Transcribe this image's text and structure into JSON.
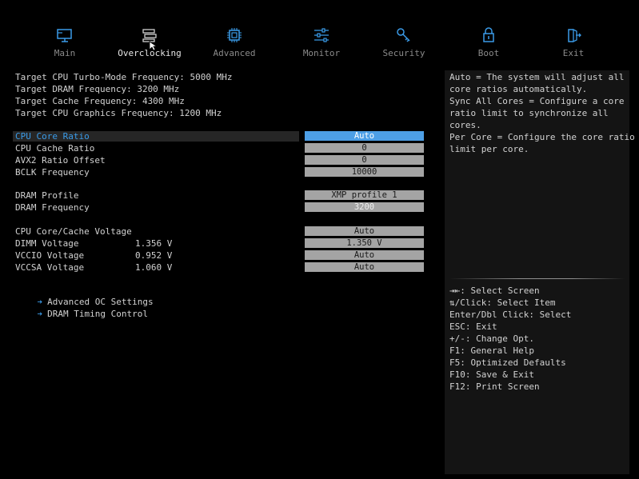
{
  "nav": {
    "items": [
      {
        "label": "Main",
        "icon": "computer-icon"
      },
      {
        "label": "Overclocking",
        "icon": "overclock-icon"
      },
      {
        "label": "Advanced",
        "icon": "chip-icon"
      },
      {
        "label": "Monitor",
        "icon": "sliders-icon"
      },
      {
        "label": "Security",
        "icon": "key-icon"
      },
      {
        "label": "Boot",
        "icon": "lock-icon"
      },
      {
        "label": "Exit",
        "icon": "exit-icon"
      }
    ],
    "active": "Overclocking",
    "accent": "#3a9be8"
  },
  "targets": [
    "Target CPU Turbo-Mode Frequency: 5000 MHz",
    "Target DRAM Frequency: 3200 MHz",
    "Target Cache Frequency: 4300 MHz",
    "Target CPU Graphics Frequency: 1200 MHz"
  ],
  "settings": {
    "cpu_core_ratio": {
      "label": "CPU Core Ratio",
      "value": "Auto"
    },
    "cpu_cache_ratio": {
      "label": "CPU Cache Ratio",
      "value": "0"
    },
    "avx2_ratio_offset": {
      "label": "AVX2 Ratio Offset",
      "value": "0"
    },
    "bclk_frequency": {
      "label": "BCLK Frequency",
      "value": "10000"
    },
    "dram_profile": {
      "label": "DRAM Profile",
      "value": "XMP profile 1"
    },
    "dram_frequency": {
      "label": "DRAM Frequency",
      "value": "3200"
    },
    "cpu_core_cache_voltage": {
      "label": "CPU Core/Cache Voltage",
      "value": "Auto"
    },
    "dimm_voltage": {
      "label": "DIMM Voltage",
      "current": "1.356 V",
      "value": "1.350 V"
    },
    "vccio_voltage": {
      "label": "VCCIO Voltage",
      "current": "0.952 V",
      "value": "Auto"
    },
    "vccsa_voltage": {
      "label": "VCCSA Voltage",
      "current": "1.060 V",
      "value": "Auto"
    }
  },
  "submenus": [
    "Advanced OC Settings",
    "DRAM Timing Control"
  ],
  "submenu_arrow": "➔",
  "help": [
    "Auto = The system will adjust all",
    "core ratios automatically.",
    "Sync All Cores = Configure a core",
    "ratio limit to synchronize all",
    "cores.",
    "Per Core = Configure the core ratio",
    "limit per core."
  ],
  "keys": [
    "⇥⇤: Select Screen",
    "⇅/Click: Select Item",
    "Enter/Dbl Click: Select",
    "ESC: Exit",
    "+/-: Change Opt.",
    "F1: General Help",
    "F5: Optimized Defaults",
    "F10: Save & Exit",
    "F12: Print Screen"
  ]
}
